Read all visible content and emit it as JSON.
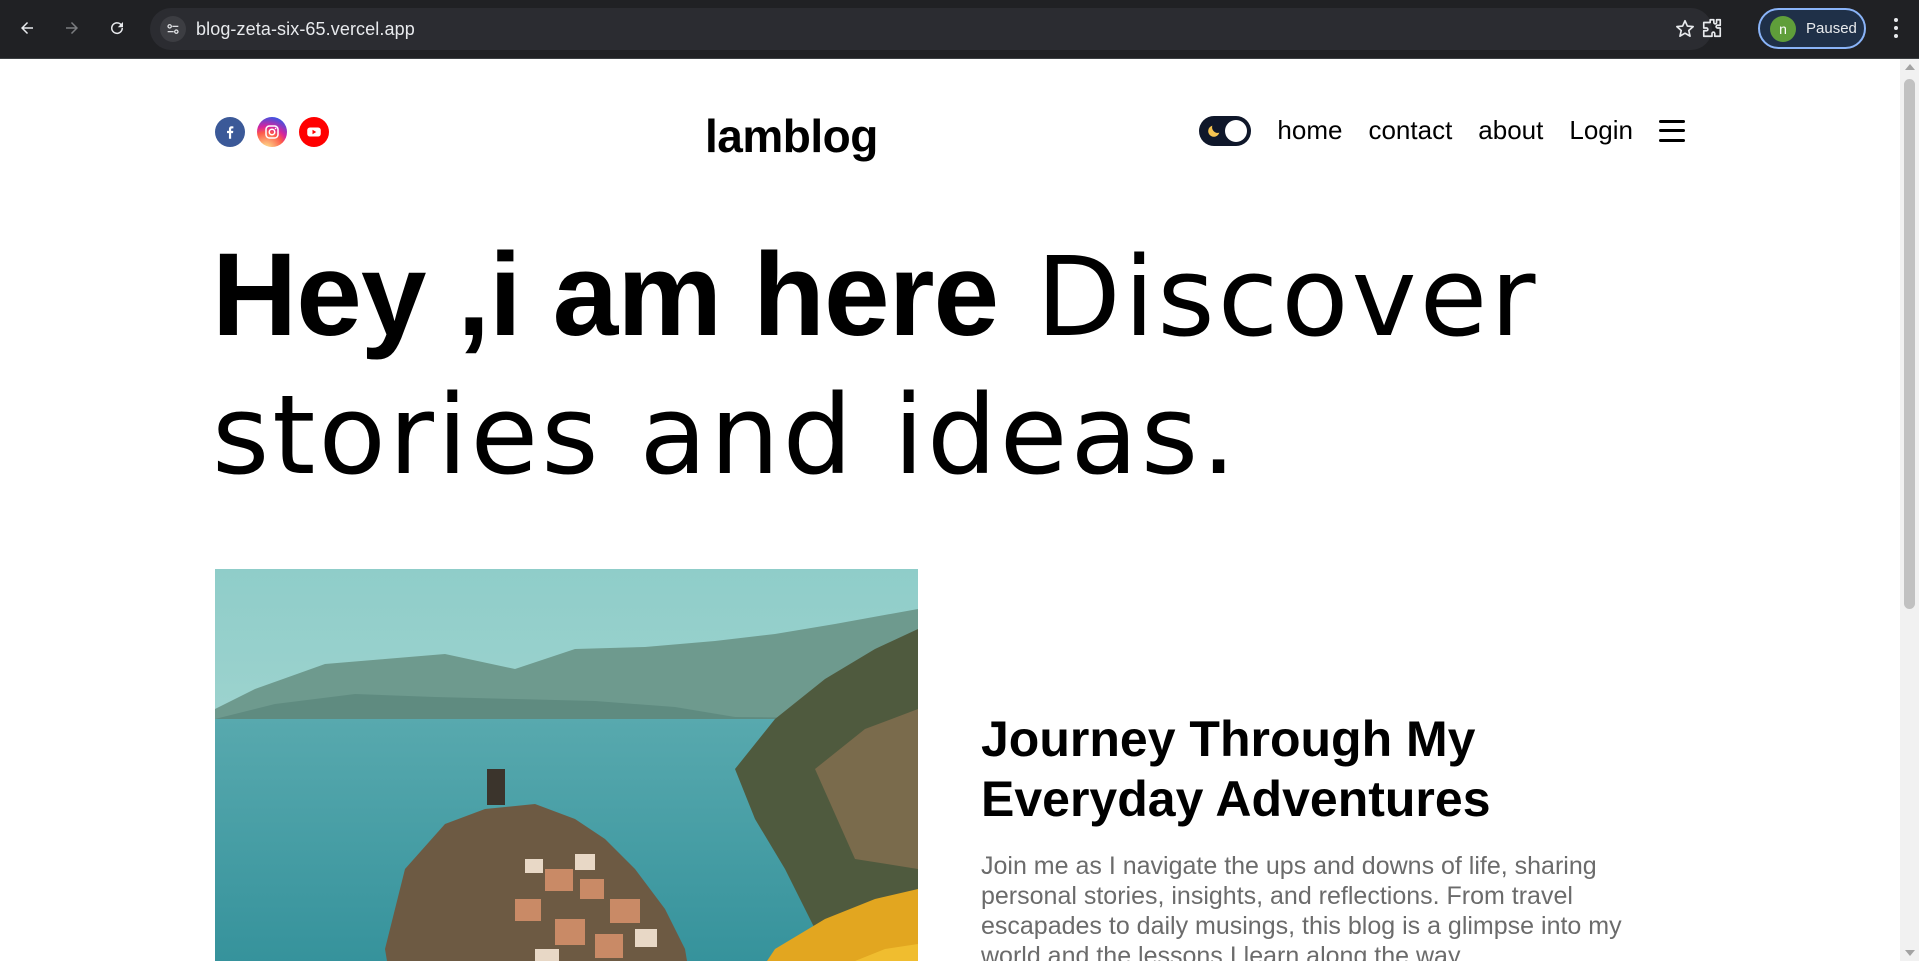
{
  "browser": {
    "url": "blog-zeta-six-65.vercel.app",
    "profile_initial": "n",
    "profile_status": "Paused"
  },
  "navbar": {
    "logo": "lamblog",
    "links": [
      "home",
      "contact",
      "about",
      "Login"
    ],
    "socials": [
      "facebook-icon",
      "instagram-icon",
      "youtube-icon"
    ],
    "theme_toggle": "dark-mode-toggle"
  },
  "hero": {
    "bold": "Hey ,i am here",
    "light": " Discover stories and ideas."
  },
  "featured": {
    "title": "Journey Through My Everyday Adventures",
    "description": "Join me as I navigate the ups and downs of life, sharing personal stories, insights, and reflections. From travel escapades to daily musings, this blog is a glimpse into my world and the lessons I learn along the way."
  },
  "colors": {
    "chrome_bg": "#202124",
    "toggle_bg": "#0f172a",
    "text": "#000000",
    "desc_text": "#6b6b6b"
  }
}
